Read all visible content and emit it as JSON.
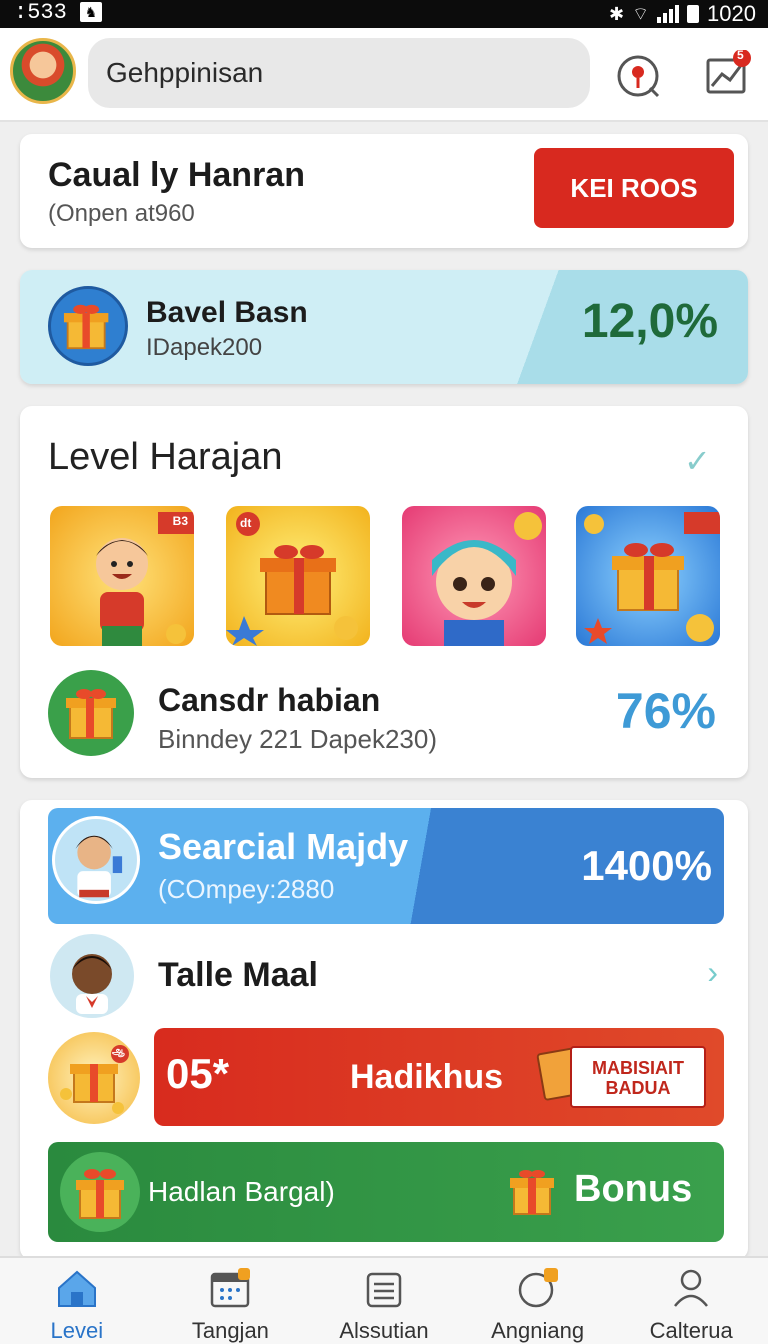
{
  "status_bar": {
    "time": ":533",
    "clock": "1020"
  },
  "header": {
    "search_text": "Gehppinisan",
    "icons": [
      "avatar",
      "location-pin-icon",
      "trend-chart-icon"
    ],
    "notification_badge": "5"
  },
  "card_top": {
    "title": "Caual ly Hanran",
    "subtitle": "(Onpen at960",
    "button": "KEI ROOS"
  },
  "card_gift": {
    "title": "Bavel Basn",
    "subtitle": "IDapek200",
    "percent": "12,0%"
  },
  "level_card": {
    "title": "Level Harajan",
    "row_title": "Cansdr habian",
    "row_subtitle": "Binndey 221 Dapek230)",
    "percent": "76%",
    "tile_tags": [
      "B3",
      "dt"
    ]
  },
  "special_card": {
    "banner_title": "Searcial Majdy",
    "banner_subtitle": "(COmpey:2880",
    "banner_percent": "1400%",
    "row_label": "Talle Maal",
    "promo_number": "05*",
    "promo_label": "Hadikhus",
    "promo_badge_line1": "MABISIAIT",
    "promo_badge_line2": "BADUA",
    "bonus_label": "Hadlan Bargal)",
    "bonus_button": "Bonus",
    "promo_icon_tag": "ஆ"
  },
  "bottom_nav": [
    {
      "label": "Levei",
      "icon": "home-icon",
      "active": true
    },
    {
      "label": "Tangjan",
      "icon": "calendar-icon",
      "active": false
    },
    {
      "label": "Alssutian",
      "icon": "list-icon",
      "active": false
    },
    {
      "label": "Angniang",
      "icon": "circle-badge-icon",
      "active": false
    },
    {
      "label": "Calterua",
      "icon": "user-icon",
      "active": false
    }
  ],
  "colors": {
    "accent_red": "#d8291f",
    "accent_blue": "#3a82d2",
    "accent_green": "#2a8a3e",
    "percent_blue": "#3e9ad6"
  }
}
